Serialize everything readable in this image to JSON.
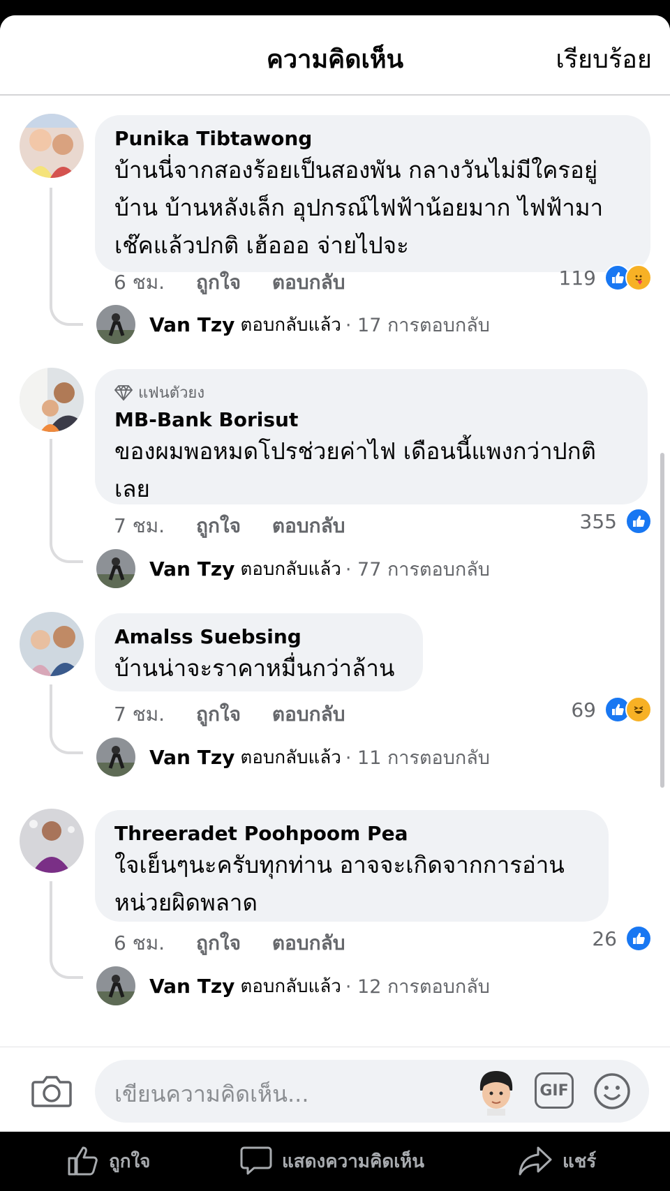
{
  "header": {
    "title": "ความคิดเห็น",
    "done_label": "เรียบร้อย"
  },
  "comments": [
    {
      "author": "Punika Tibtawong",
      "text": "บ้านนี่จากสองร้อยเป็นสองพัน กลางวันไม่มีใครอยู่บ้าน บ้านหลังเล็ก อุปกรณ์ไฟฟ้าน้อยมาก ไฟฟ้ามาเช๊คแล้วปกติ เฮ้อออ จ่ายไปจะ",
      "time": "6 ชม.",
      "like_label": "ถูกใจ",
      "reply_label": "ตอบกลับ",
      "reaction_count": "119",
      "reactions": [
        "like",
        "care"
      ],
      "reply_author": "Van Tzy",
      "reply_text": "ตอบกลับแล้ว",
      "reply_count": "· 17 การตอบกลับ"
    },
    {
      "badge": "แฟนตัวยง",
      "author": "MB-Bank Borisut",
      "text": "ของผมพอหมดโปรช่วยค่าไฟ เดือนนี้แพงกว่าปกติเลย",
      "time": "7 ชม.",
      "like_label": "ถูกใจ",
      "reply_label": "ตอบกลับ",
      "reaction_count": "355",
      "reactions": [
        "like"
      ],
      "reply_author": "Van Tzy",
      "reply_text": "ตอบกลับแล้ว",
      "reply_count": "· 77 การตอบกลับ"
    },
    {
      "author": "Amalss Suebsing",
      "text": "บ้านน่าจะราคาหมื่นกว่าล้าน",
      "time": "7 ชม.",
      "like_label": "ถูกใจ",
      "reply_label": "ตอบกลับ",
      "reaction_count": "69",
      "reactions": [
        "like",
        "haha"
      ],
      "reply_author": "Van Tzy",
      "reply_text": "ตอบกลับแล้ว",
      "reply_count": "· 11 การตอบกลับ"
    },
    {
      "author": "Threeradet Poohpoom Pea",
      "text": "ใจเย็นๆนะครับทุกท่าน อาจจะเกิดจากการอ่านหน่วยผิดพลาด",
      "time": "6 ชม.",
      "like_label": "ถูกใจ",
      "reply_label": "ตอบกลับ",
      "reaction_count": "26",
      "reactions": [
        "like"
      ],
      "reply_author": "Van Tzy",
      "reply_text": "ตอบกลับแล้ว",
      "reply_count": "· 12 การตอบกลับ"
    }
  ],
  "composer": {
    "placeholder": "เขียนความคิดเห็น...",
    "gif_label": "GIF"
  },
  "bottom_bar": {
    "like_label": "ถูกใจ",
    "comment_label": "แสดงความคิดเห็น",
    "share_label": "แชร์"
  },
  "colors": {
    "like_blue": "#1877f2",
    "bubble_bg": "#f0f2f5",
    "secondary_text": "#65676b"
  }
}
